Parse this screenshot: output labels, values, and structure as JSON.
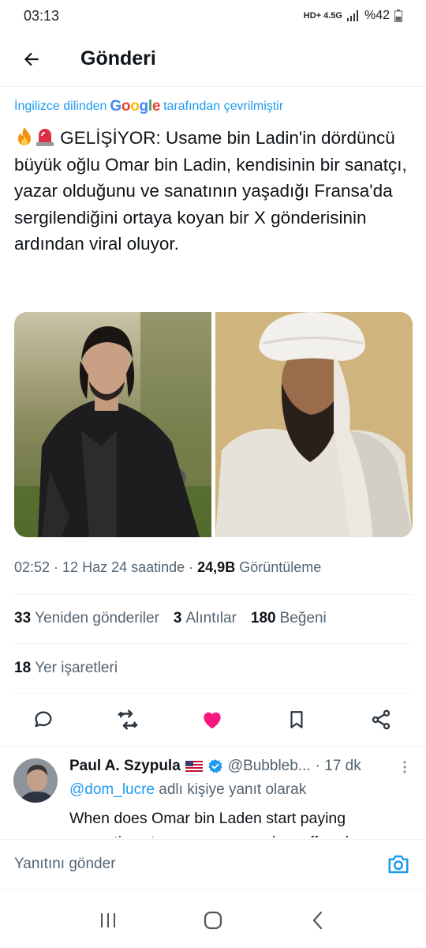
{
  "status_bar": {
    "time": "03:13",
    "network_small": "HD+ 4.5G",
    "battery": "%42"
  },
  "header": {
    "title": "Gönderi"
  },
  "translation": {
    "prefix": "İngilizce dilinden",
    "brand": "Google",
    "suffix": "tarafından çevrilmiştir"
  },
  "tweet": {
    "text": "GELİŞİYOR: Usame bin Ladin'in dördüncü büyük oğlu Omar bin Ladin, kendisinin bir sanatçı, yazar olduğunu ve sanatının yaşadığı Fransa'da sergilendiğini ortaya koyan bir X gönderisinin ardından viral oluyor.",
    "time": "02:52",
    "date": "12 Haz 24 saatinde",
    "views_count": "24,9B",
    "views_label": "Görüntüleme",
    "reposts_count": "33",
    "reposts_label": "Yeniden gönderiler",
    "quotes_count": "3",
    "quotes_label": "Alıntılar",
    "likes_count": "180",
    "likes_label": "Beğeni",
    "bookmarks_count": "18",
    "bookmarks_label": "Yer işaretleri",
    "liked": true,
    "like_color": "#f91880"
  },
  "reply": {
    "name": "Paul A. Szypula",
    "handle": "@Bubbleb...",
    "time": "· 17 dk",
    "reply_prefix": "@dom_lucre",
    "reply_suffix": "adlı kişiye yanıt olarak",
    "text": "When does Omar bin Laden start paying reparations to every person who suffered"
  },
  "composer": {
    "placeholder": "Yanıtını gönder"
  },
  "colors": {
    "accent": "#1d9bf0",
    "text": "#0f1419",
    "secondary": "#536471"
  }
}
